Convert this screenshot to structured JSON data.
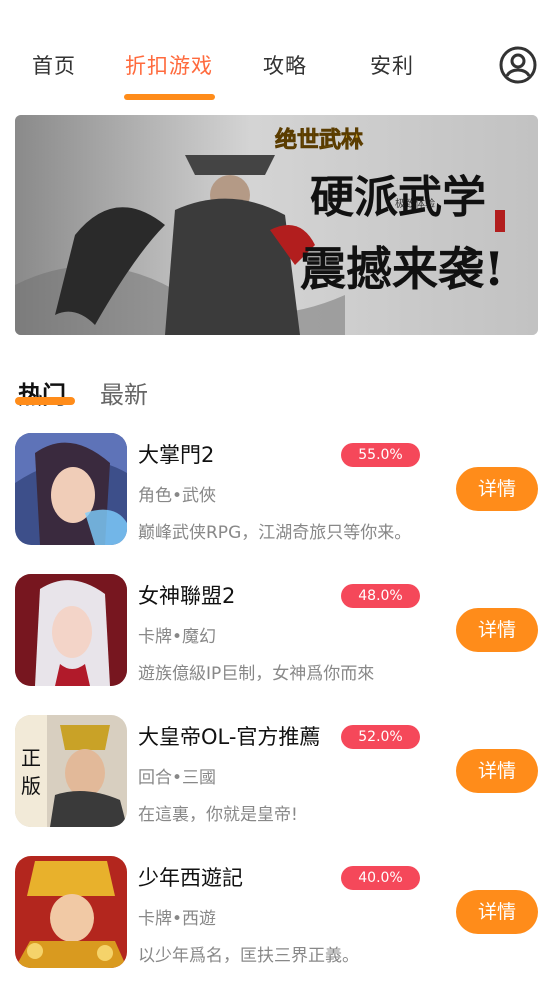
{
  "theme": {
    "accent": "#ff8c1a",
    "active_tab": "#ff6a3d",
    "discount_badge": "#f5485a",
    "underline": "#ff8c1a"
  },
  "nav": {
    "tabs": [
      {
        "label": "首页"
      },
      {
        "label": "折扣游戏"
      },
      {
        "label": "攻略"
      },
      {
        "label": "安利"
      }
    ],
    "user_icon": "user-circle-icon"
  },
  "banner": {
    "logo_text": "绝世武林",
    "small_text": "极致体验",
    "headline_1": "硬派武学",
    "headline_2": "震撼来袭!"
  },
  "subtabs": [
    {
      "label": "热门"
    },
    {
      "label": "最新"
    }
  ],
  "games": [
    {
      "title": "大掌門2",
      "discount": "55.0%",
      "tags": "角色•武俠",
      "desc": "巅峰武侠RPG，江湖奇旅只等你来。",
      "button": "详情"
    },
    {
      "title": "女神聯盟2",
      "discount": "48.0%",
      "tags": "卡牌•魔幻",
      "desc": "遊族億級IP巨制，女神爲你而來",
      "button": "详情"
    },
    {
      "title": "大皇帝OL-官方推薦",
      "discount": "52.0%",
      "tags": "回合•三國",
      "desc": "在這裏，你就是皇帝!",
      "button": "详情"
    },
    {
      "title": "少年西遊記",
      "discount": "40.0%",
      "tags": "卡牌•西遊",
      "desc": "以少年爲名，匡扶三界正義。",
      "button": "详情"
    }
  ]
}
